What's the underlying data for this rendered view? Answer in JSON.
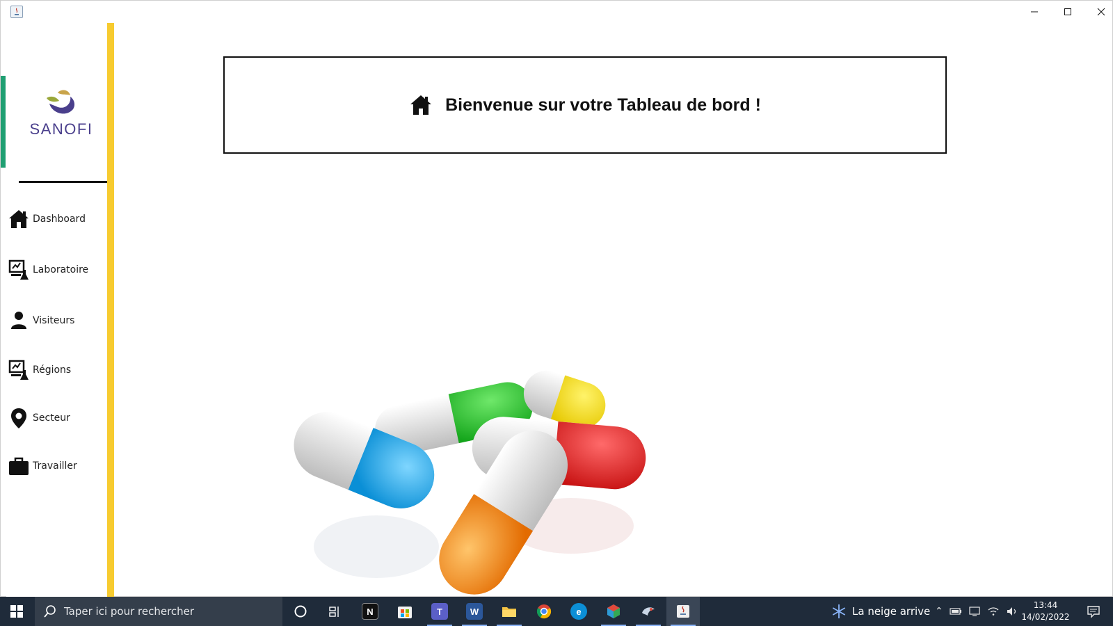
{
  "window": {
    "title": "",
    "controls": {
      "minimize_icon": "minimize-icon",
      "maximize_icon": "maximize-icon",
      "close_icon": "close-icon"
    }
  },
  "brand": {
    "logo_text": "SANOFI",
    "colors": {
      "primary": "#4a3f8c",
      "accent": "#f7cb2f",
      "edge": "#1f9f72"
    }
  },
  "sidebar": {
    "items": [
      {
        "label": "Dashboard",
        "icon": "home-icon"
      },
      {
        "label": "Laboratoire",
        "icon": "lab-computer-icon"
      },
      {
        "label": "Visiteurs",
        "icon": "person-icon"
      },
      {
        "label": "Régions",
        "icon": "region-computer-icon"
      },
      {
        "label": "Secteur",
        "icon": "map-pin-icon"
      },
      {
        "label": "Travailler",
        "icon": "briefcase-icon"
      }
    ]
  },
  "main": {
    "welcome": "Bienvenue sur votre Tableau de bord !",
    "welcome_icon": "home-icon",
    "illustration": "pills-image"
  },
  "taskbar": {
    "search_placeholder": "Taper ici pour rechercher",
    "apps": [
      {
        "name": "cortana",
        "glyph": ""
      },
      {
        "name": "task-view",
        "glyph": ""
      },
      {
        "name": "notion",
        "glyph": "N"
      },
      {
        "name": "store",
        "glyph": ""
      },
      {
        "name": "teams",
        "glyph": "T"
      },
      {
        "name": "word",
        "glyph": "W"
      },
      {
        "name": "explorer",
        "glyph": ""
      },
      {
        "name": "chrome",
        "glyph": ""
      },
      {
        "name": "edge",
        "glyph": "e"
      },
      {
        "name": "app-cube",
        "glyph": ""
      },
      {
        "name": "app-bird",
        "glyph": ""
      },
      {
        "name": "java",
        "glyph": ""
      }
    ],
    "weather_text": "La neige arrive",
    "time": "13:44",
    "date": "14/02/2022"
  }
}
